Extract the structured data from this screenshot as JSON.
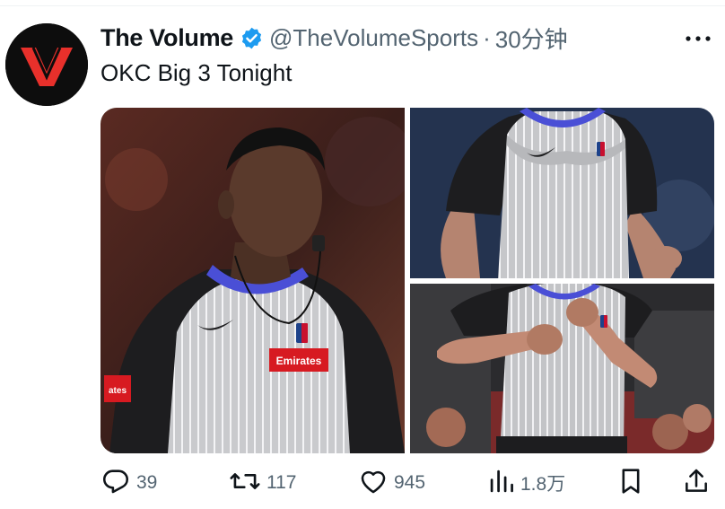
{
  "tweet": {
    "author_name": "The Volume",
    "handle": "@TheVolumeSports",
    "separator": "·",
    "time": "30分钟",
    "text": "OKC Big 3 Tonight",
    "avatar_letter": "V",
    "verified_color": "#1d9bf0",
    "brand_color": "#e8302b"
  },
  "photos": {
    "p1_sponsor": "Emirates",
    "p1_sleeve": "ates"
  },
  "actions": {
    "reply_count": "39",
    "retweet_count": "117",
    "like_count": "945",
    "views_count": "1.8万"
  },
  "icons": {
    "reply": "reply-icon",
    "retweet": "retweet-icon",
    "like": "heart-icon",
    "views": "views-icon",
    "bookmark": "bookmark-icon",
    "share": "share-icon",
    "more": "more-icon",
    "verified": "verified-badge-icon"
  }
}
